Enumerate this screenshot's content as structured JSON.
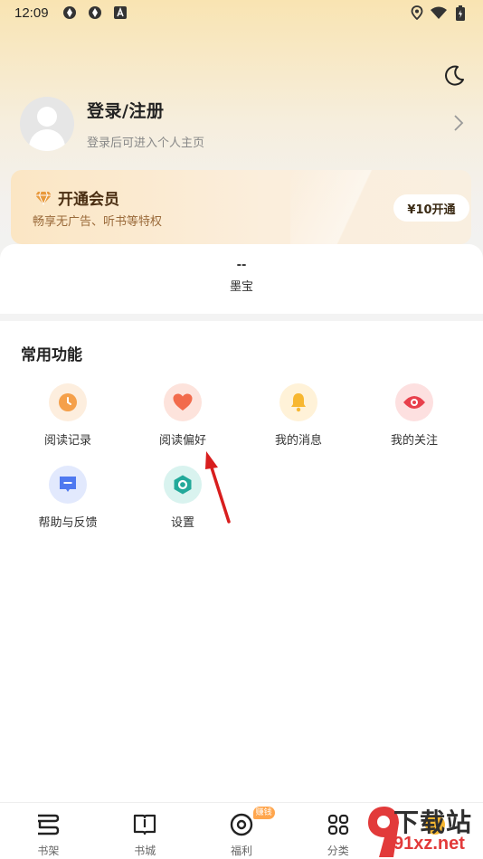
{
  "status_bar": {
    "time": "12:09"
  },
  "profile": {
    "title": "登录/注册",
    "subtitle": "登录后可进入个人主页"
  },
  "vip": {
    "title": "开通会员",
    "subtitle": "畅享无广告、听书等特权",
    "button": "¥10开通"
  },
  "mobao": {
    "value": "--",
    "label": "墨宝"
  },
  "section_title": "常用功能",
  "functions": [
    {
      "label": "阅读记录",
      "icon": "clock-icon",
      "color": "#f5a04a",
      "bg": "#fdeede"
    },
    {
      "label": "阅读偏好",
      "icon": "heart-icon",
      "color": "#f26b4c",
      "bg": "#fde3dc"
    },
    {
      "label": "我的消息",
      "icon": "bell-icon",
      "color": "#f7b731",
      "bg": "#fff2d8"
    },
    {
      "label": "我的关注",
      "icon": "eye-icon",
      "color": "#e8404c",
      "bg": "#fde0e0"
    },
    {
      "label": "帮助与反馈",
      "icon": "chat-icon",
      "color": "#4f79f0",
      "bg": "#e2e9fd"
    },
    {
      "label": "设置",
      "icon": "hexagon-settings-icon",
      "color": "#22a99a",
      "bg": "#d9f3ef"
    }
  ],
  "bottom_nav": [
    {
      "label": "书架",
      "icon": "bookshelf-icon"
    },
    {
      "label": "书城",
      "icon": "book-icon"
    },
    {
      "label": "福利",
      "icon": "welfare-icon",
      "badge": "赚钱"
    },
    {
      "label": "分类",
      "icon": "category-icon"
    },
    {
      "label": "",
      "icon": "profile-icon"
    }
  ],
  "watermark": {
    "title": "下载站",
    "site": "91xz.net"
  },
  "colors": {
    "accent": "#e8404c",
    "vip_text": "#4a2e12",
    "arrow": "#d81e1e"
  }
}
